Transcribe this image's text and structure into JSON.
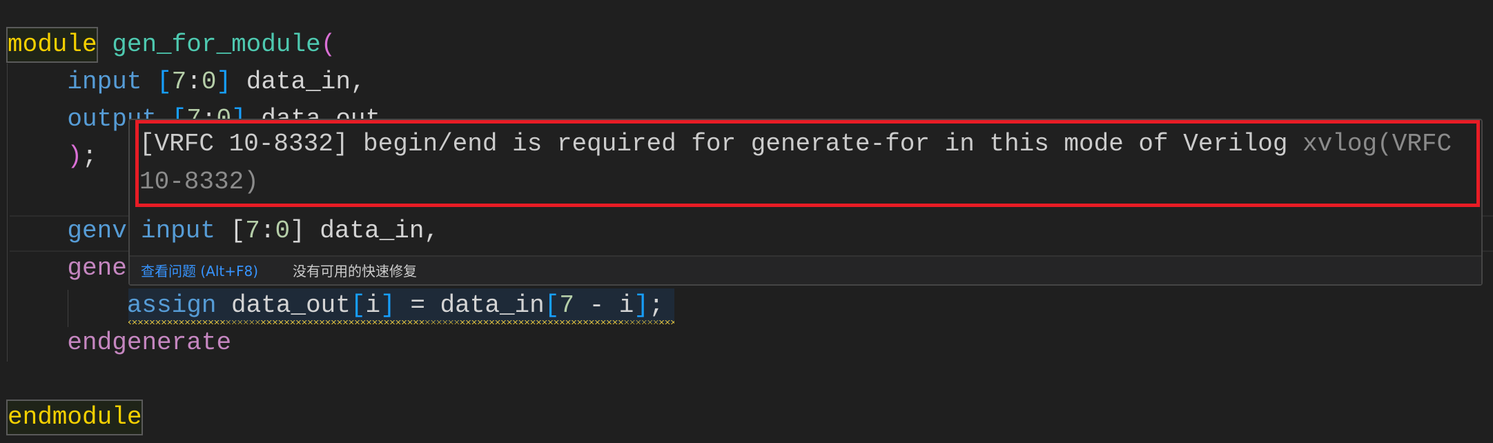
{
  "editor": {
    "lines": [
      [
        {
          "c": "t-kw",
          "t": "module"
        },
        {
          "c": "t-id",
          "t": " "
        },
        {
          "c": "t-mod",
          "t": "gen_for_module"
        },
        {
          "c": "t-paren",
          "t": "("
        }
      ],
      [
        {
          "c": "t-id",
          "t": "    "
        },
        {
          "c": "t-type",
          "t": "input"
        },
        {
          "c": "t-id",
          "t": " "
        },
        {
          "c": "t-brk",
          "t": "["
        },
        {
          "c": "t-num",
          "t": "7"
        },
        {
          "c": "t-id",
          "t": ":"
        },
        {
          "c": "t-num",
          "t": "0"
        },
        {
          "c": "t-brk",
          "t": "]"
        },
        {
          "c": "t-id",
          "t": " data_in,"
        }
      ],
      [
        {
          "c": "t-id",
          "t": "    "
        },
        {
          "c": "t-type",
          "t": "output"
        },
        {
          "c": "t-id",
          "t": " "
        },
        {
          "c": "t-brk",
          "t": "["
        },
        {
          "c": "t-num",
          "t": "7"
        },
        {
          "c": "t-id",
          "t": ":"
        },
        {
          "c": "t-num",
          "t": "0"
        },
        {
          "c": "t-brk",
          "t": "]"
        },
        {
          "c": "t-id",
          "t": " data_out,"
        }
      ],
      [
        {
          "c": "t-id",
          "t": "    "
        },
        {
          "c": "t-paren",
          "t": ")"
        },
        {
          "c": "t-id",
          "t": ";"
        }
      ],
      [],
      [
        {
          "c": "t-id",
          "t": "    "
        },
        {
          "c": "t-type",
          "t": "genv"
        }
      ],
      [
        {
          "c": "t-id",
          "t": "    "
        },
        {
          "c": "t-gen",
          "t": "gene"
        }
      ],
      [
        {
          "c": "t-id",
          "t": "        "
        },
        {
          "c": "t-type",
          "t": "assign"
        },
        {
          "c": "t-id",
          "t": " data_out"
        },
        {
          "c": "t-brk",
          "t": "["
        },
        {
          "c": "t-id",
          "t": "i"
        },
        {
          "c": "t-brk",
          "t": "]"
        },
        {
          "c": "t-id",
          "t": " = data_in"
        },
        {
          "c": "t-brk",
          "t": "["
        },
        {
          "c": "t-num",
          "t": "7"
        },
        {
          "c": "t-id",
          "t": " - i"
        },
        {
          "c": "t-brk",
          "t": "]"
        },
        {
          "c": "t-id",
          "t": ";"
        }
      ],
      [
        {
          "c": "t-id",
          "t": "    "
        },
        {
          "c": "t-gen",
          "t": "endgenerate"
        }
      ],
      [],
      [
        {
          "c": "t-kw",
          "t": "endmodule"
        }
      ]
    ]
  },
  "hover": {
    "message": "[VRFC 10-8332] begin/end is required for generate-for in this mode of Verilog",
    "source": "xvlog(VRFC 10-8332)",
    "code_preview": [
      {
        "c": "t-type",
        "t": "input"
      },
      {
        "c": "t-id",
        "t": " "
      },
      {
        "c": "t-id",
        "t": "["
      },
      {
        "c": "t-num",
        "t": "7"
      },
      {
        "c": "t-id",
        "t": ":"
      },
      {
        "c": "t-num",
        "t": "0"
      },
      {
        "c": "t-id",
        "t": "]"
      },
      {
        "c": "t-id",
        "t": " data_in,"
      }
    ],
    "view_problem_label": "查看问题 (Alt+F8)",
    "no_quick_fix_label": "没有可用的快速修复"
  },
  "colors": {
    "background": "#1f1f1f",
    "highlight_box": "#e81c25",
    "warning_squiggle": "#d7ba3d",
    "link": "#3794ff"
  }
}
